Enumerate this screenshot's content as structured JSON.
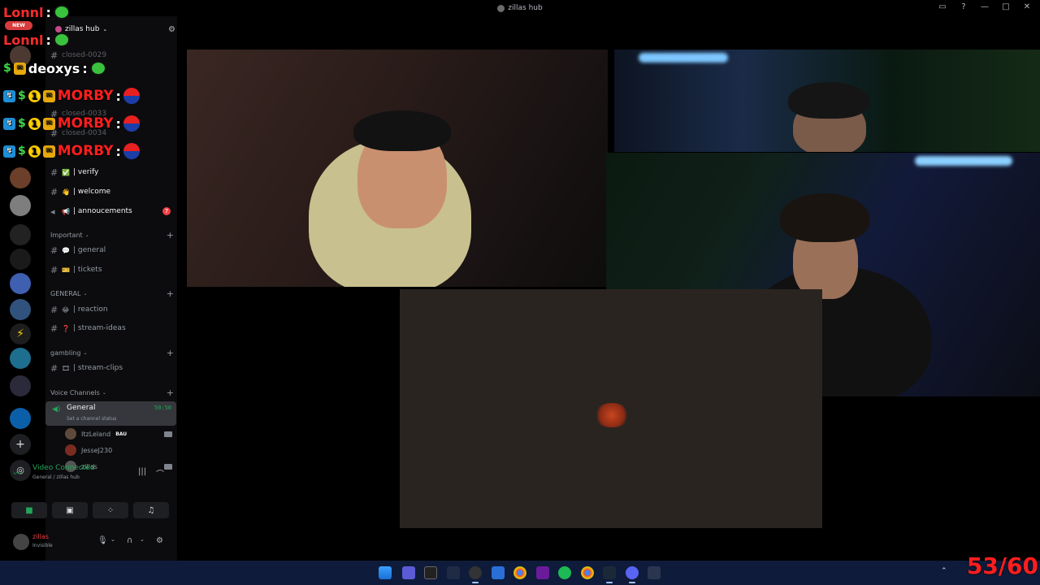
{
  "window": {
    "title": "zillas hub"
  },
  "server": {
    "name": "zillas hub"
  },
  "channels": {
    "closed_items": [
      "closed-0029",
      "closed-0033",
      "closed-0034"
    ],
    "top": [
      {
        "emoji": "✅",
        "label": "| verify"
      },
      {
        "emoji": "👋",
        "label": "| welcome"
      },
      {
        "emoji": "📢",
        "label": "| annoucements",
        "badge": "7"
      }
    ],
    "categories": [
      {
        "name": "Important",
        "items": [
          {
            "emoji": "💬",
            "label": "| general"
          },
          {
            "emoji": "🎫",
            "label": "| tickets"
          }
        ]
      },
      {
        "name": "GENERAL",
        "items": [
          {
            "emoji": "😂",
            "label": "| reaction"
          },
          {
            "emoji": "❓",
            "label": "| stream-ideas"
          }
        ]
      },
      {
        "name": "gambling",
        "items": [
          {
            "emoji": "🎞",
            "label": "| stream-clips"
          }
        ]
      }
    ],
    "voice_category": "Voice Channels",
    "voice_channel": {
      "name": "General",
      "timer": "50:50",
      "status": "Set a channel status"
    },
    "voice_users": [
      {
        "name": "ItzLeland",
        "tag": "BAU"
      },
      {
        "name": "JesseJ230",
        "tag": ""
      },
      {
        "name": "zillas",
        "tag": ""
      }
    ]
  },
  "voice_panel": {
    "title": "Video Connected",
    "subtitle": "General / zillas hub"
  },
  "user_panel": {
    "name": "zillas",
    "status": "Invisible"
  },
  "overlay": {
    "new_label": "NEW",
    "rows": [
      {
        "name": "Lonnl",
        "colon": ":"
      },
      {
        "name": "Lonnl",
        "colon": ":"
      },
      {
        "name": "deoxys",
        "colon": ":"
      },
      {
        "name": "MORBY",
        "colon": ":"
      },
      {
        "name": "MORBY",
        "colon": ":"
      },
      {
        "name": "MORBY",
        "colon": ":"
      }
    ]
  },
  "fps": "53/60",
  "colors": {
    "accent_green": "#23a55a",
    "danger": "#f23f43",
    "taskbar": "#0f1b3a"
  }
}
